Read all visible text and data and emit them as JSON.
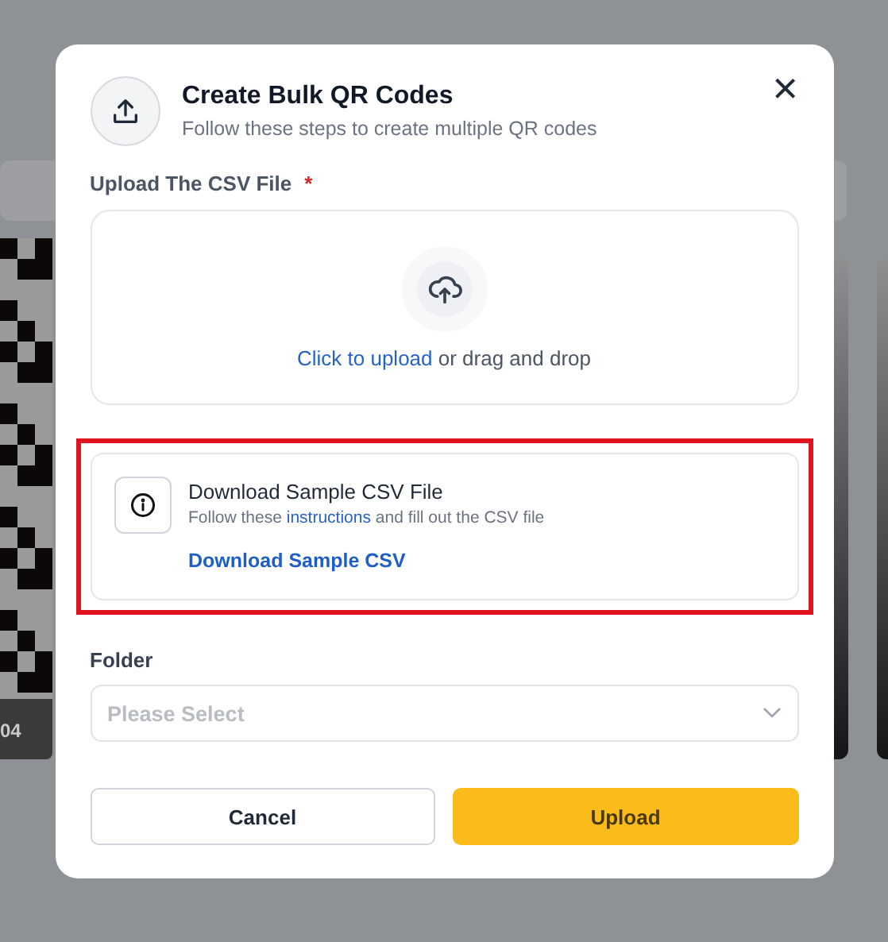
{
  "backdrop": {
    "card_label": "04"
  },
  "modal": {
    "title": "Create Bulk QR Codes",
    "subtitle": "Follow these steps to create multiple QR codes",
    "close": "×"
  },
  "upload": {
    "label": "Upload The CSV File",
    "required_mark": "*",
    "link": "Click to upload",
    "rest": " or drag and drop"
  },
  "sample": {
    "highlighted": true,
    "title": "Download Sample CSV File",
    "text_before": "Follow these ",
    "link": "instructions",
    "text_after": " and fill out the CSV file",
    "download": "Download Sample CSV"
  },
  "folder": {
    "label": "Folder",
    "placeholder": "Please Select"
  },
  "buttons": [
    {
      "label": "Cancel",
      "kind": "secondary"
    },
    {
      "label": "Upload",
      "kind": "primary"
    }
  ]
}
